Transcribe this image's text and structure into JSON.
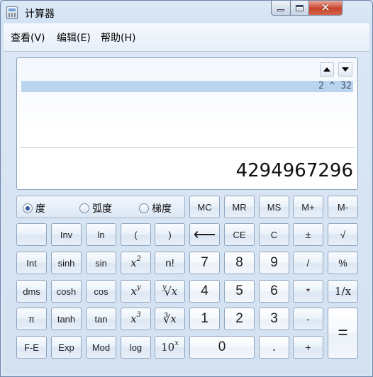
{
  "window": {
    "title": "计算器",
    "controls": {
      "minimize": "",
      "maximize": "",
      "close": "✕"
    }
  },
  "menu": [
    "查看(V)",
    "编辑(E)",
    "帮助(H)"
  ],
  "display": {
    "expression": "2 ^ 32",
    "result": "4294967296"
  },
  "angle_units": [
    {
      "label": "度",
      "selected": true
    },
    {
      "label": "弧度",
      "selected": false
    },
    {
      "label": "梯度",
      "selected": false
    }
  ],
  "buttons": {
    "mc": "MC",
    "mr": "MR",
    "ms": "MS",
    "mplus": "M+",
    "mminus": "M-",
    "blank": "",
    "inv": "Inv",
    "ln": "ln",
    "lparen": "(",
    "rparen": ")",
    "backspace": "⟵",
    "ce": "CE",
    "c": "C",
    "plusminus": "±",
    "sqrt": "√",
    "int": "Int",
    "sinh": "sinh",
    "sin": "sin",
    "x2_base": "x",
    "x2_exp": "2",
    "factorial": "n!",
    "d7": "7",
    "d8": "8",
    "d9": "9",
    "divide": "/",
    "percent": "%",
    "dms": "dms",
    "cosh": "cosh",
    "cos": "cos",
    "xy_base": "x",
    "xy_exp": "y",
    "yroot_idx": "y",
    "yroot_sym": "√",
    "yroot_x": "x",
    "d4": "4",
    "d5": "5",
    "d6": "6",
    "multiply": "*",
    "reciprocal": "1/x",
    "pi": "π",
    "tanh": "tanh",
    "tan": "tan",
    "x3_base": "x",
    "x3_exp": "3",
    "croot_sym": "∛",
    "croot_x": "x",
    "d1": "1",
    "d2": "2",
    "d3": "3",
    "minus": "-",
    "equals": "=",
    "fe": "F-E",
    "exp": "Exp",
    "mod": "Mod",
    "log": "log",
    "ten_base": "10",
    "ten_exp": "x",
    "d0": "0",
    "decimal": ".",
    "plus": "+"
  }
}
